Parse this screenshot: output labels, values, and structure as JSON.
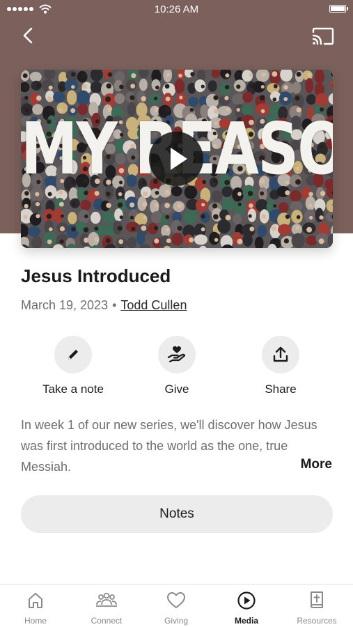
{
  "status_bar": {
    "time": "10:26 AM"
  },
  "video": {
    "series_title": "MY REASON"
  },
  "sermon": {
    "title": "Jesus Introduced",
    "date": "March 19, 2023",
    "separator": "•",
    "author": "Todd Cullen"
  },
  "actions": [
    {
      "label": "Take a note",
      "icon": "pencil-icon"
    },
    {
      "label": "Give",
      "icon": "hand-heart-icon"
    },
    {
      "label": "Share",
      "icon": "share-icon"
    }
  ],
  "description": {
    "text": "In week 1 of our new series, we'll discover how Jesus was first introduced to the world as the one, true Messiah.",
    "more_label": "More"
  },
  "notes_button": {
    "label": "Notes"
  },
  "tabs": [
    {
      "label": "Home",
      "icon": "home-icon",
      "active": false
    },
    {
      "label": "Connect",
      "icon": "people-icon",
      "active": false
    },
    {
      "label": "Giving",
      "icon": "heart-icon",
      "active": false
    },
    {
      "label": "Media",
      "icon": "play-circle-icon",
      "active": true
    },
    {
      "label": "Resources",
      "icon": "bible-icon",
      "active": false
    }
  ],
  "colors": {
    "header_background": "#7b605b",
    "button_background": "#ececec",
    "text_primary": "#1b1b1b",
    "text_secondary": "#6e6e6e"
  }
}
